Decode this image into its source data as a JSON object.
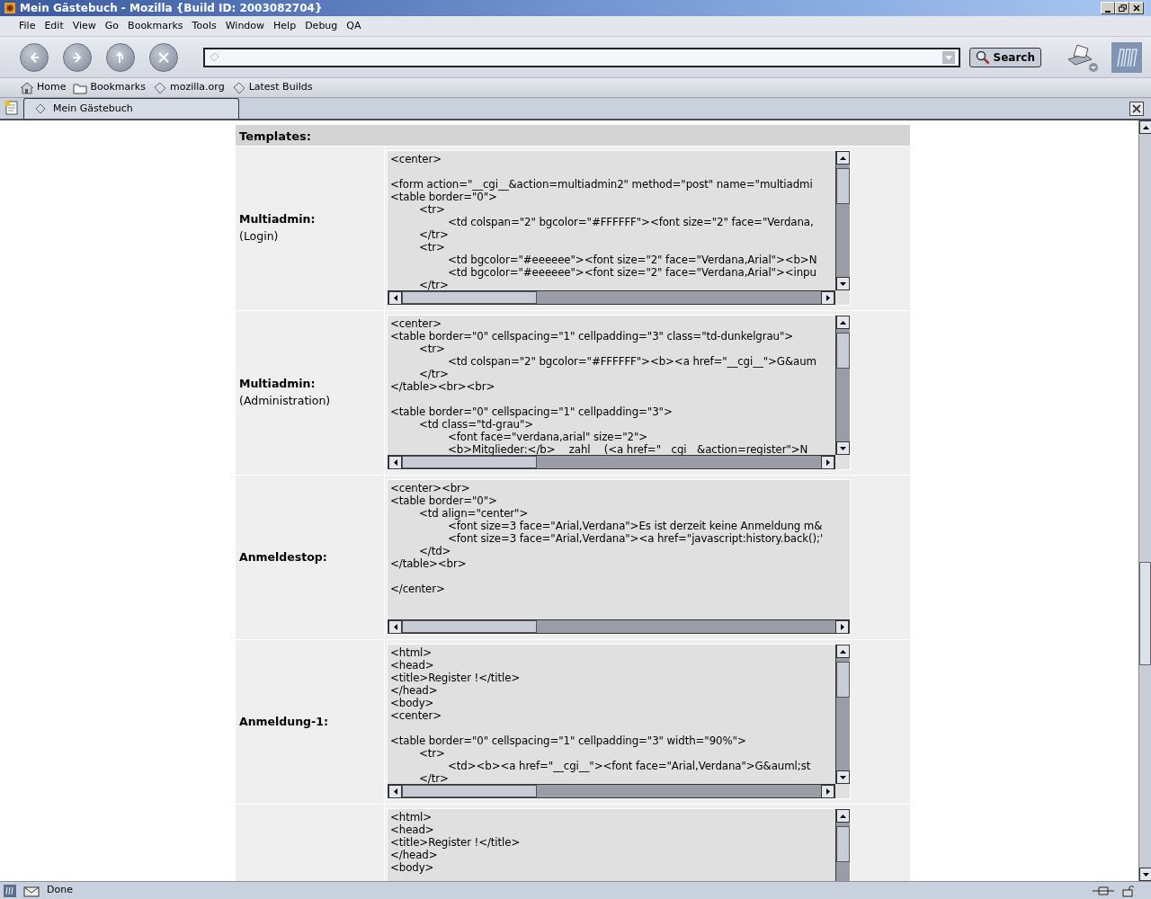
{
  "window": {
    "title": "Mein Gästebuch - Mozilla {Build ID: 2003082704}"
  },
  "menu": [
    "File",
    "Edit",
    "View",
    "Go",
    "Bookmarks",
    "Tools",
    "Window",
    "Help",
    "Debug",
    "QA"
  ],
  "navigation": {
    "search_button": "Search"
  },
  "personal_toolbar": [
    {
      "kind": "home",
      "label": "Home"
    },
    {
      "kind": "folder",
      "label": "Bookmarks"
    },
    {
      "kind": "link",
      "label": "mozilla.org"
    },
    {
      "kind": "link",
      "label": "Latest Builds"
    }
  ],
  "tabs": [
    {
      "label": "Mein Gästebuch",
      "selected": true
    }
  ],
  "content": {
    "heading": "Templates:",
    "rows": [
      {
        "label": "Multiadmin:",
        "sublabel": "(Login)",
        "vscroll": true,
        "code": "<center>\n\n<form action=\"__cgi__&action=multiadmin2\" method=\"post\" name=\"multiadmi\n<table border=\"0\">\n\t<tr>\n\t\t<td colspan=\"2\" bgcolor=\"#FFFFFF\"><font size=\"2\" face=\"Verdana,\n\t</tr>\n\t<tr>\n\t\t<td bgcolor=\"#eeeeee\"><font size=\"2\" face=\"Verdana,Arial\"><b>N\n\t\t<td bgcolor=\"#eeeeee\"><font size=\"2\" face=\"Verdana,Arial\"><inpu\n\t</tr>"
      },
      {
        "label": "Multiadmin:",
        "sublabel": "(Administration)",
        "vscroll": true,
        "code": "<center>\n<table border=\"0\" cellspacing=\"1\" cellpadding=\"3\" class=\"td-dunkelgrau\">\n\t<tr>\n\t\t<td colspan=\"2\" bgcolor=\"#FFFFFF\"><b><a href=\"__cgi__\">G&aum\n\t</tr>\n</table><br><br>\n\n<table border=\"0\" cellspacing=\"1\" cellpadding=\"3\">\n\t<td class=\"td-grau\">\n\t\t<font face=\"verdana,arial\" size=\"2\">\n\t\t<b>Mitglieder:</b> __zahl__ (<a href=\"__cgi__&action=register\">N"
      },
      {
        "label": "Anmeldestop:",
        "vscroll": false,
        "code": "<center><br>\n<table border=\"0\">\n\t<td align=\"center\">\n\t\t<font size=3 face=\"Arial,Verdana\">Es ist derzeit keine Anmeldung m&\n\t\t<font size=3 face=\"Arial,Verdana\"><a href=\"javascript:history.back();'\n\t</td>\n</table><br>\n\n</center>"
      },
      {
        "label": "Anmeldung-1:",
        "vscroll": true,
        "code": "<html>\n<head>\n<title>Register !</title>\n</head>\n<body>\n<center>\n\n<table border=\"0\" cellspacing=\"1\" cellpadding=\"3\" width=\"90%\">\n\t<tr>\n\t\t<td><b><a href=\"__cgi__\"><font face=\"Arial,Verdana\">G&auml;st\n\t</tr>"
      },
      {
        "vscroll": true,
        "code": "<html>\n<head>\n<title>Register !</title>\n</head>\n<body>"
      }
    ]
  },
  "status_bar": {
    "text": "Done"
  }
}
